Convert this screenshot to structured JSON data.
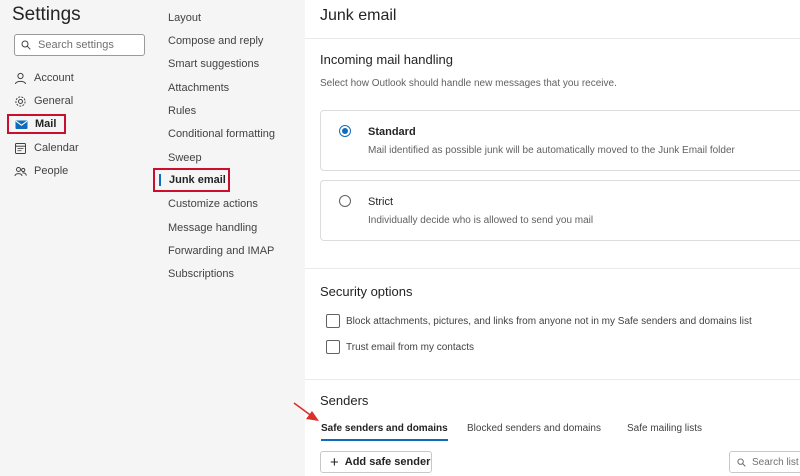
{
  "settings": {
    "title": "Settings",
    "search_placeholder": "Search settings",
    "categories": [
      {
        "label": "Account",
        "icon": "person-icon"
      },
      {
        "label": "General",
        "icon": "gear-icon"
      },
      {
        "label": "Mail",
        "icon": "mail-icon"
      },
      {
        "label": "Calendar",
        "icon": "calendar-icon"
      },
      {
        "label": "People",
        "icon": "people-icon"
      }
    ]
  },
  "mail_menu": {
    "items": [
      "Layout",
      "Compose and reply",
      "Smart suggestions",
      "Attachments",
      "Rules",
      "Conditional formatting",
      "Sweep",
      "Junk email",
      "Customize actions",
      "Message handling",
      "Forwarding and IMAP",
      "Subscriptions"
    ],
    "selected": "Junk email"
  },
  "junk": {
    "title": "Junk email",
    "incoming": {
      "heading": "Incoming mail handling",
      "description": "Select how Outlook should handle new messages that you receive.",
      "options": [
        {
          "label": "Standard",
          "description": "Mail identified as possible junk will be automatically moved to the Junk Email folder",
          "checked": true
        },
        {
          "label": "Strict",
          "description": "Individually decide who is allowed to send you mail",
          "checked": false
        }
      ]
    },
    "security": {
      "heading": "Security options",
      "checks": [
        {
          "label": "Block attachments, pictures, and links from anyone not in my Safe senders and domains list",
          "checked": false
        },
        {
          "label": "Trust email from my contacts",
          "checked": false
        }
      ]
    },
    "senders": {
      "heading": "Senders",
      "tabs": [
        "Safe senders and domains",
        "Blocked senders and domains",
        "Safe mailing lists"
      ],
      "selected_tab": "Safe senders and domains",
      "add_button": "Add safe sender",
      "search_placeholder": "Search list"
    }
  },
  "colors": {
    "accent": "#0f6cbd",
    "highlight_box": "#c8102e",
    "arrow": "#d9302c"
  }
}
